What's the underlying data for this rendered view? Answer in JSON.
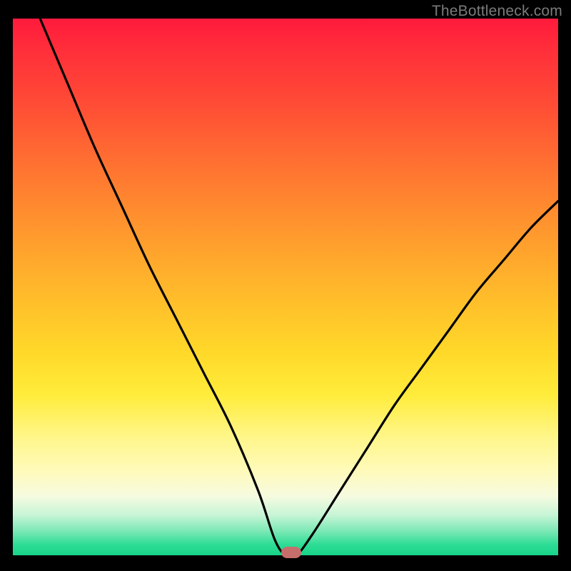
{
  "watermark": {
    "text": "TheBottleneck.com"
  },
  "chart_data": {
    "type": "line",
    "title": "",
    "xlabel": "",
    "ylabel": "",
    "xlim": [
      0,
      100
    ],
    "ylim": [
      0,
      100
    ],
    "grid": false,
    "legend": false,
    "series": [
      {
        "name": "bottleneck-curve",
        "x": [
          5,
          10,
          15,
          20,
          25,
          30,
          35,
          40,
          45,
          48,
          50,
          52,
          55,
          60,
          65,
          70,
          75,
          80,
          85,
          90,
          95,
          100
        ],
        "y": [
          100,
          88,
          76,
          65,
          54,
          44,
          34,
          24,
          12,
          3,
          0,
          0,
          4,
          12,
          20,
          28,
          35,
          42,
          49,
          55,
          61,
          66
        ]
      }
    ],
    "marker": {
      "x": 51,
      "y": 0.5,
      "color": "#c66e6b"
    },
    "background_gradient": {
      "top": "#ff1a3c",
      "mid": "#ffd829",
      "bottom": "#18d489"
    }
  }
}
